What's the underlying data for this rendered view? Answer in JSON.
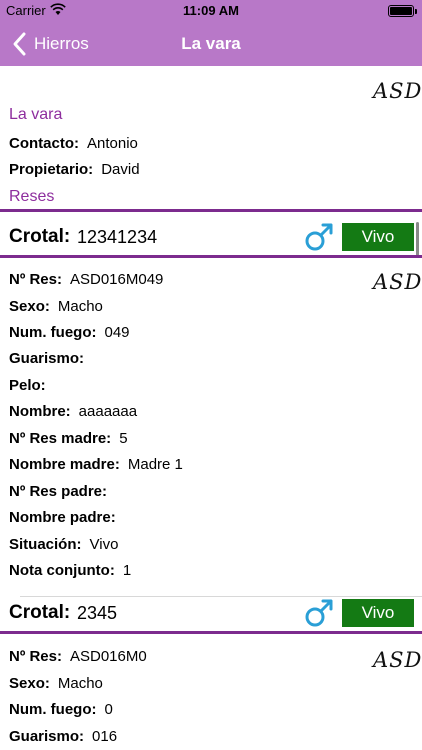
{
  "status_bar": {
    "carrier": "Carrier",
    "time": "11:09 AM"
  },
  "nav": {
    "back_label": "Hierros",
    "title": "La vara"
  },
  "header": {
    "logo": "ASD",
    "name": "La vara",
    "contacto_label": "Contacto:",
    "contacto_value": "Antonio",
    "propietario_label": "Propietario:",
    "propietario_value": "David",
    "reses_label": "Reses"
  },
  "animals": [
    {
      "crotal_label": "Crotal:",
      "crotal": "12341234",
      "status": "Vivo",
      "logo": "ASD",
      "fields": [
        {
          "label": "Nº Res:",
          "value": "ASD016M049"
        },
        {
          "label": "Sexo:",
          "value": "Macho"
        },
        {
          "label": "Num. fuego:",
          "value": "049"
        },
        {
          "label": "Guarismo:",
          "value": ""
        },
        {
          "label": "Pelo:",
          "value": ""
        },
        {
          "label": "Nombre:",
          "value": "aaaaaaa"
        },
        {
          "label": "Nº Res madre:",
          "value": "5"
        },
        {
          "label": "Nombre madre:",
          "value": "Madre 1"
        },
        {
          "label": "Nº Res padre:",
          "value": ""
        },
        {
          "label": "Nombre padre:",
          "value": ""
        },
        {
          "label": "Situación:",
          "value": "Vivo"
        },
        {
          "label": "Nota conjunto:",
          "value": "1"
        }
      ]
    },
    {
      "crotal_label": "Crotal:",
      "crotal": "2345",
      "status": "Vivo",
      "logo": "ASD",
      "fields": [
        {
          "label": "Nº Res:",
          "value": "ASD016M0"
        },
        {
          "label": "Sexo:",
          "value": "Macho"
        },
        {
          "label": "Num. fuego:",
          "value": "0"
        },
        {
          "label": "Guarismo:",
          "value": "016"
        }
      ]
    }
  ],
  "colors": {
    "nav": "#b878c8",
    "accent": "#8e2e9e",
    "divider": "#7c2b8e",
    "vivo": "#147a14",
    "male": "#2a9fd6"
  }
}
